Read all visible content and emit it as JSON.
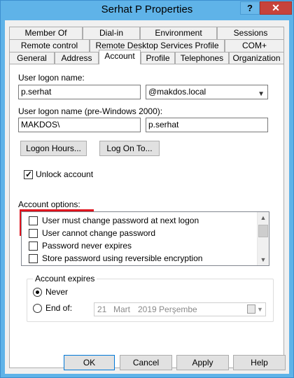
{
  "window": {
    "title": "Serhat P Properties",
    "help_button": "?",
    "close_button": "✕"
  },
  "tabs_row1": [
    "Member Of",
    "Dial-in",
    "Environment",
    "Sessions"
  ],
  "tabs_row2": [
    "Remote control",
    "Remote Desktop Services Profile",
    "COM+"
  ],
  "tabs_row3": [
    "General",
    "Address",
    "Account",
    "Profile",
    "Telephones",
    "Organization"
  ],
  "active_tab": "Account",
  "account": {
    "logon_name_label": "User logon name:",
    "logon_name_value": "p.serhat",
    "domain_value": "@makdos.local",
    "pre2000_label": "User logon name (pre-Windows 2000):",
    "pre2000_domain": "MAKDOS\\",
    "pre2000_user": "p.serhat",
    "logon_hours_button": "Logon Hours...",
    "log_on_to_button": "Log On To...",
    "unlock_label": "Unlock account",
    "unlock_checked": true,
    "options_label": "Account options:",
    "options": [
      {
        "label": "User must change password at next logon",
        "checked": false
      },
      {
        "label": "User cannot change password",
        "checked": false
      },
      {
        "label": "Password never expires",
        "checked": false
      },
      {
        "label": "Store password using reversible encryption",
        "checked": false
      }
    ],
    "expires_label": "Account expires",
    "never_label": "Never",
    "never_selected": true,
    "endof_label": "End of:",
    "date_day": "21",
    "date_month": "Mart",
    "date_year_day": "2019 Perşembe"
  },
  "buttons": {
    "ok": "OK",
    "cancel": "Cancel",
    "apply": "Apply",
    "help": "Help"
  },
  "colors": {
    "highlight_border": "#e0141e",
    "titlebar": "#5fb3e8",
    "close_button": "#c7433b"
  }
}
